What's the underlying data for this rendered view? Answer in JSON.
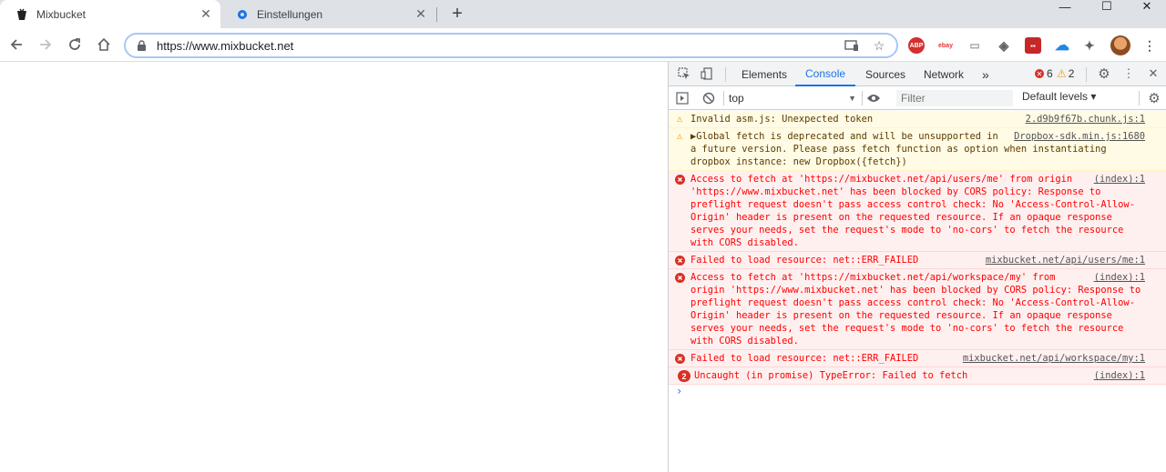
{
  "tabs": [
    {
      "title": "Mixbucket",
      "icon": "bucket-icon",
      "active": true
    },
    {
      "title": "Einstellungen",
      "icon": "settings-gear-icon",
      "active": false
    }
  ],
  "new_tab_label": "+",
  "window_controls": {
    "minimize": "—",
    "maximize": "☐",
    "close": "✕"
  },
  "toolbar": {
    "url": "https://www.mixbucket.net",
    "extensions": [
      {
        "name": "adblock-plus-icon",
        "label": "ABP",
        "color": "#d32f2f"
      },
      {
        "name": "ebay-icon",
        "label": "ebay",
        "color": "#e53238"
      },
      {
        "name": "extension-grey-icon",
        "label": "▭",
        "color": "#9aa0a6"
      },
      {
        "name": "extension-shield-icon",
        "label": "◈",
        "color": "#5f6368"
      },
      {
        "name": "extension-red-icon",
        "label": "▪▪",
        "color": "#c62828"
      },
      {
        "name": "extension-cloud-icon",
        "label": "☁",
        "color": "#1e88e5"
      },
      {
        "name": "puzzle-icon",
        "label": "✦",
        "color": "#5f6368"
      }
    ]
  },
  "devtools": {
    "tabs": [
      "Elements",
      "Console",
      "Sources",
      "Network"
    ],
    "active_tab": "Console",
    "more_tabs": "»",
    "error_count": "6",
    "warning_count": "2",
    "context": "top",
    "filter_placeholder": "Filter",
    "levels": "Default levels ▾",
    "messages": [
      {
        "type": "warn",
        "text": "Invalid asm.js: Unexpected token",
        "source": "2.d9b9f67b.chunk.js:1"
      },
      {
        "type": "warn",
        "text": "▶Global fetch is deprecated and will be unsupported in a future version. Please pass fetch function as option when instantiating dropbox instance: new Dropbox({fetch})",
        "source": "Dropbox-sdk.min.js:1680"
      },
      {
        "type": "err",
        "text": "Access to fetch at 'https://mixbucket.net/api/users/me' from origin 'https://www.mixbucket.net' has been blocked by CORS policy: Response to preflight request doesn't pass access control check: No 'Access-Control-Allow-Origin' header is present on the requested resource. If an opaque response serves your needs, set the request's mode to 'no-cors' to fetch the resource with CORS disabled.",
        "source": "(index):1"
      },
      {
        "type": "err",
        "text": "Failed to load resource: net::ERR_FAILED",
        "source": "mixbucket.net/api/users/me:1"
      },
      {
        "type": "err",
        "text": "Access to fetch at 'https://mixbucket.net/api/workspace/my' from origin 'https://www.mixbucket.net' has been blocked by CORS policy: Response to preflight request doesn't pass access control check: No 'Access-Control-Allow-Origin' header is present on the requested resource. If an opaque response serves your needs, set the request's mode to 'no-cors' to fetch the resource with CORS disabled.",
        "source": "(index):1"
      },
      {
        "type": "err",
        "text": "Failed to load resource: net::ERR_FAILED",
        "source": "mixbucket.net/api/workspace/my:1"
      },
      {
        "type": "err",
        "text": "Uncaught (in promise) TypeError: Failed to fetch",
        "source": "(index):1",
        "repeat": "2"
      }
    ],
    "prompt": "›"
  }
}
